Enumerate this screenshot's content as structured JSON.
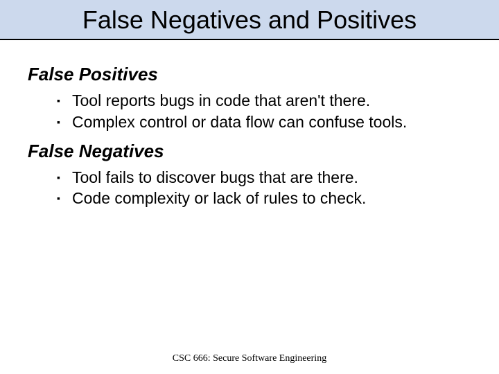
{
  "title": "False Negatives and Positives",
  "sections": [
    {
      "heading": "False Positives",
      "bullets": [
        "Tool reports bugs in code that aren't there.",
        "Complex control or data flow can confuse tools."
      ]
    },
    {
      "heading": "False Negatives",
      "bullets": [
        "Tool fails to discover bugs that are there.",
        "Code complexity or lack of rules to check."
      ]
    }
  ],
  "footer": "CSC 666: Secure Software Engineering"
}
